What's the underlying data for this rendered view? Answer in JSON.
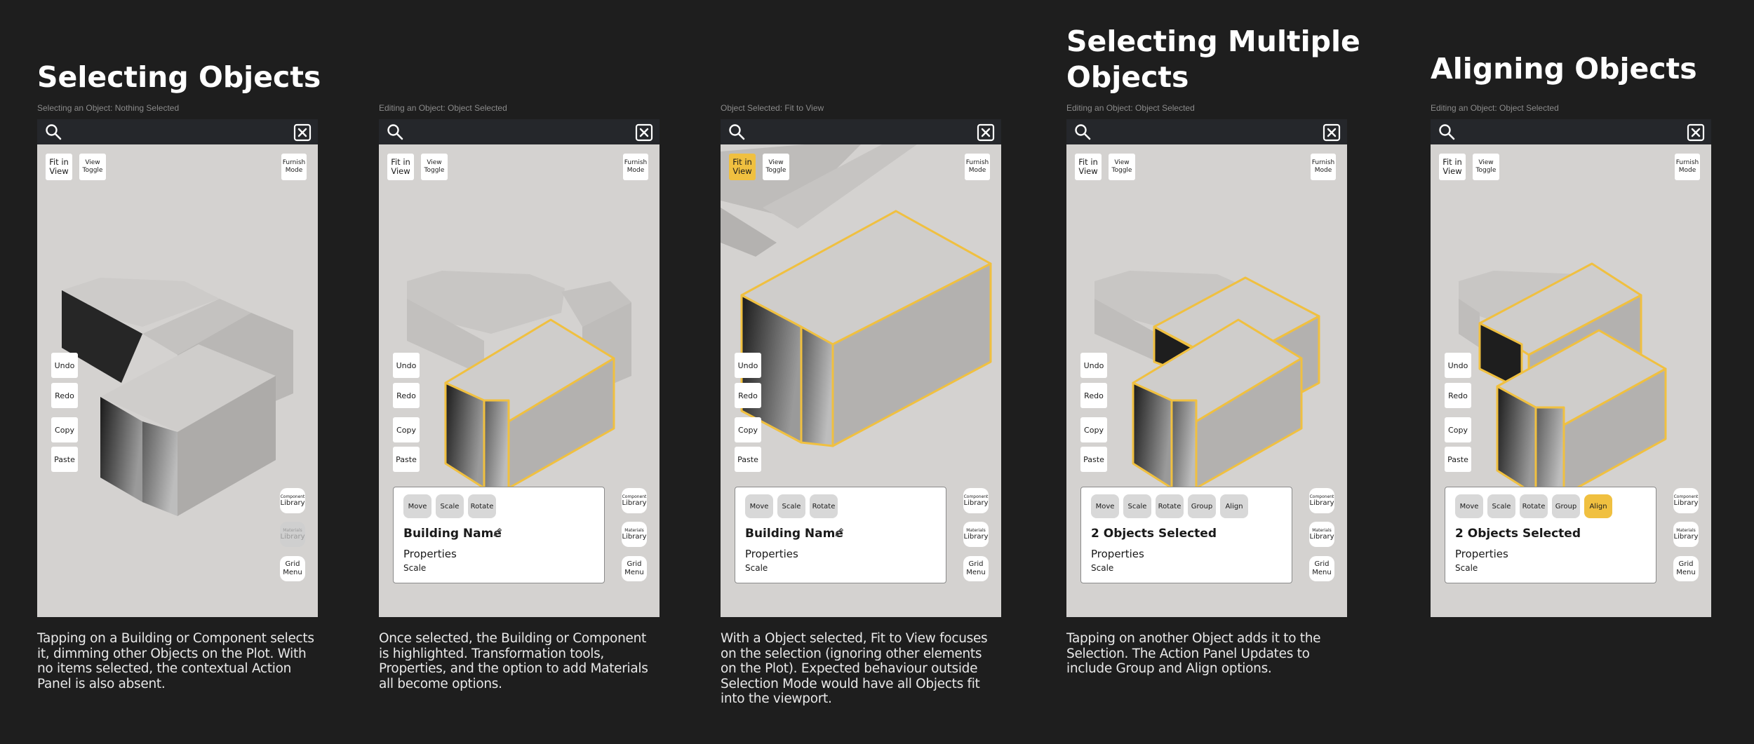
{
  "screens": [
    {
      "heading_lines": [
        "Selecting Objects"
      ],
      "caption": "Selecting an Object: Nothing Selected",
      "fit_btn": "Fit in View",
      "view_btn": "View Toggle",
      "furnish_btn": "Furnish Mode",
      "side_buttons": [
        "Undo",
        "Redo",
        "Copy",
        "Paste"
      ],
      "library_buttons": {
        "component_tiny": "Component",
        "component": "Library",
        "materials_tiny": "Materials",
        "materials": "Library",
        "grid": "Grid Menu"
      },
      "materials_disabled": true,
      "description": "Tapping on a Building or Component selects it, dimming other Objects on the Plot. With no items selected, the contextual Action Panel is also absent."
    },
    {
      "heading_lines": [],
      "caption": "Editing an Object: Object Selected",
      "fit_btn": "Fit in View",
      "view_btn": "View Toggle",
      "furnish_btn": "Furnish Mode",
      "side_buttons": [
        "Undo",
        "Redo",
        "Copy",
        "Paste"
      ],
      "library_buttons": {
        "component_tiny": "Component",
        "component": "Library",
        "materials_tiny": "Materials",
        "materials": "Library",
        "grid": "Grid Menu"
      },
      "panel": {
        "tools": [
          "Move",
          "Scale",
          "Rotate"
        ],
        "active_tool": "",
        "title": "Building Name",
        "properties": "Properties",
        "scale": "Scale",
        "editable": true
      },
      "description": "Once selected, the Building or Component is highlighted. Transformation tools, Properties, and the option to add Materials all become options."
    },
    {
      "heading_lines": [],
      "caption": "Object Selected: Fit to View",
      "fit_btn": "Fit in View",
      "fit_active": true,
      "view_btn": "View Toggle",
      "furnish_btn": "Furnish Mode",
      "side_buttons": [
        "Undo",
        "Redo",
        "Copy",
        "Paste"
      ],
      "library_buttons": {
        "component_tiny": "Component",
        "component": "Library",
        "materials_tiny": "Materials",
        "materials": "Library",
        "grid": "Grid Menu"
      },
      "panel": {
        "tools": [
          "Move",
          "Scale",
          "Rotate"
        ],
        "active_tool": "",
        "title": "Building Name",
        "properties": "Properties",
        "scale": "Scale",
        "editable": true
      },
      "description": "With a Object selected, Fit to View focuses on the selection (ignoring other elements on the Plot). Expected behaviour outside Selection Mode would have all Objects fit into the viewport."
    },
    {
      "heading_lines": [
        "Selecting Multiple",
        "Objects"
      ],
      "caption": "Editing an Object: Object Selected",
      "fit_btn": "Fit in View",
      "view_btn": "View Toggle",
      "furnish_btn": "Furnish Mode",
      "side_buttons": [
        "Undo",
        "Redo",
        "Copy",
        "Paste"
      ],
      "library_buttons": {
        "component_tiny": "Component",
        "component": "Library",
        "materials_tiny": "Materials",
        "materials": "Library",
        "grid": "Grid Menu"
      },
      "panel": {
        "tools": [
          "Move",
          "Scale",
          "Rotate",
          "Group",
          "Align"
        ],
        "active_tool": "",
        "title": "2 Objects Selected",
        "properties": "Properties",
        "scale": "Scale",
        "editable": false
      },
      "description": "Tapping on another Object adds it to the Selection. The Action Panel Updates to include Group and Align options."
    },
    {
      "heading_lines": [
        "Aligning Objects"
      ],
      "caption": "Editing an Object: Object Selected",
      "fit_btn": "Fit in View",
      "view_btn": "View Toggle",
      "furnish_btn": "Furnish Mode",
      "side_buttons": [
        "Undo",
        "Redo",
        "Copy",
        "Paste"
      ],
      "library_buttons": {
        "component_tiny": "Component",
        "component": "Library",
        "materials_tiny": "Materials",
        "materials": "Library",
        "grid": "Grid Menu"
      },
      "panel": {
        "tools": [
          "Move",
          "Scale",
          "Rotate",
          "Group",
          "Align"
        ],
        "active_tool": "Align",
        "title": "2 Objects Selected",
        "properties": "Properties",
        "scale": "Scale",
        "editable": false
      },
      "description": ""
    }
  ],
  "colors": {
    "background": "#1e1e1e",
    "topbar": "#25272b",
    "viewport": "#d4d2d0",
    "highlight": "#f0c040"
  },
  "icons": [
    "search-icon",
    "close-icon",
    "pencil-icon"
  ]
}
